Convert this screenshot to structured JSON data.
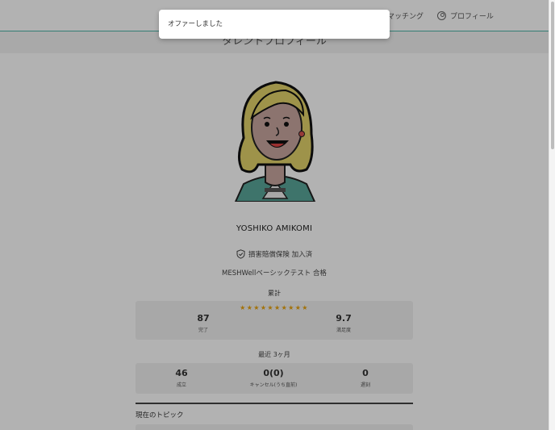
{
  "header": {
    "nav_matching": "マッチング",
    "nav_profile": "プロフィール"
  },
  "page_title": "タレントプロフィール",
  "profile": {
    "name": "YOSHIKO AMIKOMI",
    "insurance": "損害賠償保険 加入済",
    "test": "MESHWellベーシックテスト 合格"
  },
  "totals": {
    "label": "累計",
    "stars": "★★★★★★★★★★",
    "completed_value": "87",
    "completed_label": "完了",
    "satisfaction_value": "9.7",
    "satisfaction_label": "満足度"
  },
  "recent": {
    "label": "最近 3ヶ月",
    "success_value": "46",
    "success_label": "成立",
    "cancel_value": "0(0)",
    "cancel_label": "キャンセル(うち直前)",
    "late_value": "0",
    "late_label": "遅刻"
  },
  "topic": {
    "title": "現在のトピック"
  },
  "toast": {
    "message": "オファーしました"
  },
  "colors": {
    "accent": "#4ab3a6",
    "star": "#e8a20c",
    "overlay": "rgba(0,0,0,0.30)"
  }
}
